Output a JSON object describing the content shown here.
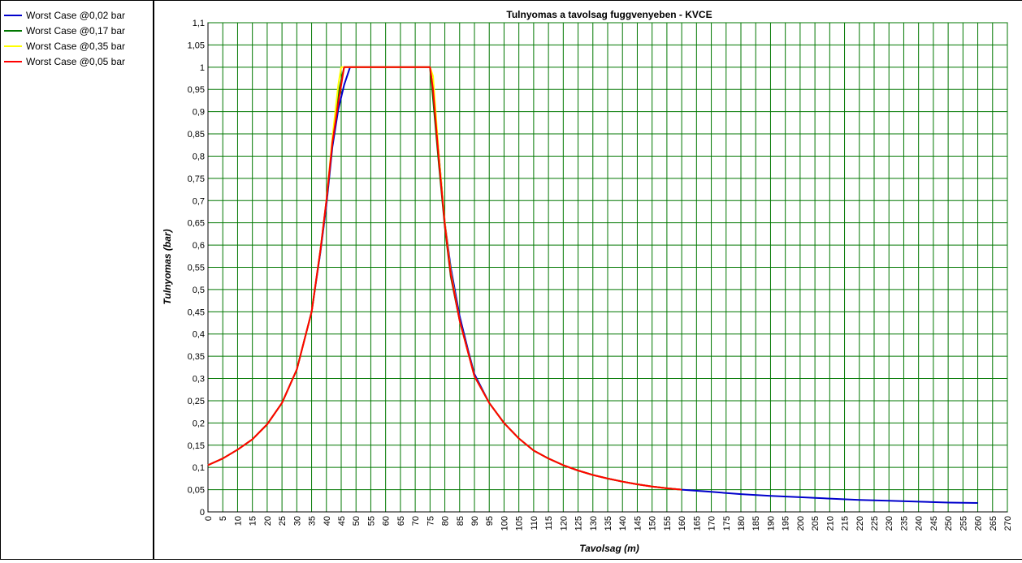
{
  "legend": {
    "items": [
      {
        "label": "Worst Case @0,02 bar",
        "color": "#0000cc"
      },
      {
        "label": "Worst Case @0,17 bar",
        "color": "#007700"
      },
      {
        "label": "Worst Case @0,35 bar",
        "color": "#ffff00"
      },
      {
        "label": "Worst Case @0,05 bar",
        "color": "#ff0000"
      }
    ]
  },
  "chart_data": {
    "type": "line",
    "title": "Tulnyomas a tavolsag fuggvenyeben - KVCE",
    "xlabel": "Tavolsag (m)",
    "ylabel": "Tulnyomas (bar)",
    "xlim": [
      0,
      270
    ],
    "ylim": [
      0,
      1.1
    ],
    "xticks": [
      "0",
      "5",
      "10",
      "15",
      "20",
      "25",
      "30",
      "35",
      "40",
      "45",
      "50",
      "55",
      "60",
      "65",
      "70",
      "75",
      "80",
      "85",
      "90",
      "95",
      "100",
      "105",
      "110",
      "115",
      "120",
      "125",
      "130",
      "135",
      "140",
      "145",
      "150",
      "155",
      "160",
      "165",
      "170",
      "175",
      "180",
      "185",
      "190",
      "195",
      "200",
      "205",
      "210",
      "215",
      "220",
      "225",
      "230",
      "235",
      "240",
      "245",
      "250",
      "255",
      "260",
      "265",
      "270"
    ],
    "yticks": [
      "0",
      "0,05",
      "0,1",
      "0,15",
      "0,2",
      "0,25",
      "0,3",
      "0,35",
      "0,4",
      "0,45",
      "0,5",
      "0,55",
      "0,6",
      "0,65",
      "0,7",
      "0,75",
      "0,8",
      "0,85",
      "0,9",
      "0,95",
      "1",
      "1,05",
      "1,1"
    ],
    "grid": true,
    "grid_color": "#007700",
    "legend_placement": "left panel",
    "series": [
      {
        "name": "Worst Case @0,02 bar",
        "color": "#0000cc",
        "x": [
          0,
          5,
          10,
          15,
          20,
          25,
          30,
          35,
          38,
          40,
          42,
          44,
          46,
          48,
          50,
          55,
          60,
          65,
          70,
          75,
          76,
          78,
          80,
          82,
          85,
          88,
          90,
          95,
          100,
          105,
          110,
          115,
          120,
          125,
          130,
          135,
          140,
          145,
          150,
          155,
          160,
          170,
          180,
          190,
          200,
          210,
          220,
          230,
          240,
          250,
          260
        ],
        "y": [
          0.105,
          0.12,
          0.14,
          0.163,
          0.197,
          0.245,
          0.32,
          0.45,
          0.585,
          0.69,
          0.82,
          0.905,
          0.96,
          1,
          1,
          1,
          1,
          1,
          1,
          1,
          0.95,
          0.8,
          0.65,
          0.55,
          0.44,
          0.36,
          0.31,
          0.245,
          0.2,
          0.165,
          0.138,
          0.12,
          0.105,
          0.093,
          0.083,
          0.075,
          0.068,
          0.062,
          0.057,
          0.053,
          0.05,
          0.045,
          0.04,
          0.036,
          0.033,
          0.03,
          0.027,
          0.025,
          0.023,
          0.021,
          0.02
        ]
      },
      {
        "name": "Worst Case @0,17 bar",
        "color": "#007700",
        "x": [
          0,
          5,
          10,
          15,
          20,
          25,
          30,
          35,
          38,
          40,
          42,
          44,
          45,
          46,
          50,
          55,
          60,
          65,
          70,
          75,
          76,
          78,
          80,
          82,
          85,
          88,
          90,
          95,
          100,
          105,
          110,
          115,
          120,
          125,
          130,
          135,
          140,
          145,
          150,
          155,
          160
        ],
        "y": [
          0.105,
          0.12,
          0.14,
          0.163,
          0.197,
          0.245,
          0.32,
          0.45,
          0.59,
          0.7,
          0.83,
          0.94,
          0.97,
          1,
          1,
          1,
          1,
          1,
          1,
          1,
          0.93,
          0.78,
          0.64,
          0.53,
          0.43,
          0.355,
          0.305,
          0.245,
          0.2,
          0.165,
          0.138,
          0.12,
          0.105,
          0.093,
          0.083,
          0.075,
          0.068,
          0.062,
          0.057,
          0.053,
          0.05
        ]
      },
      {
        "name": "Worst Case @0,35 bar",
        "color": "#ffff00",
        "x": [
          0,
          5,
          10,
          15,
          20,
          25,
          30,
          35,
          38,
          40,
          42,
          44,
          45,
          50,
          55,
          60,
          65,
          70,
          75,
          76,
          78,
          80,
          82,
          85,
          88,
          90,
          95,
          100,
          105,
          110,
          115,
          120,
          125,
          130,
          135,
          140,
          145,
          150,
          155,
          160
        ],
        "y": [
          0.105,
          0.12,
          0.14,
          0.163,
          0.197,
          0.245,
          0.32,
          0.45,
          0.59,
          0.7,
          0.84,
          0.96,
          1,
          1,
          1,
          1,
          1,
          1,
          1,
          0.98,
          0.8,
          0.65,
          0.54,
          0.43,
          0.355,
          0.305,
          0.245,
          0.2,
          0.165,
          0.138,
          0.12,
          0.105,
          0.093,
          0.083,
          0.075,
          0.068,
          0.062,
          0.057,
          0.053,
          0.05
        ]
      },
      {
        "name": "Worst Case @0,05 bar",
        "color": "#ff0000",
        "x": [
          0,
          5,
          10,
          15,
          20,
          25,
          30,
          35,
          38,
          40,
          42,
          44,
          45,
          46,
          50,
          55,
          60,
          65,
          70,
          75,
          76,
          78,
          80,
          82,
          85,
          88,
          90,
          95,
          100,
          105,
          110,
          115,
          120,
          125,
          130,
          135,
          140,
          145,
          150,
          155,
          160
        ],
        "y": [
          0.105,
          0.12,
          0.14,
          0.163,
          0.197,
          0.245,
          0.32,
          0.45,
          0.59,
          0.7,
          0.83,
          0.92,
          0.96,
          1,
          1,
          1,
          1,
          1,
          1,
          1,
          0.95,
          0.79,
          0.645,
          0.535,
          0.43,
          0.355,
          0.305,
          0.245,
          0.2,
          0.165,
          0.138,
          0.12,
          0.105,
          0.093,
          0.083,
          0.075,
          0.068,
          0.062,
          0.057,
          0.053,
          0.05
        ]
      }
    ]
  }
}
